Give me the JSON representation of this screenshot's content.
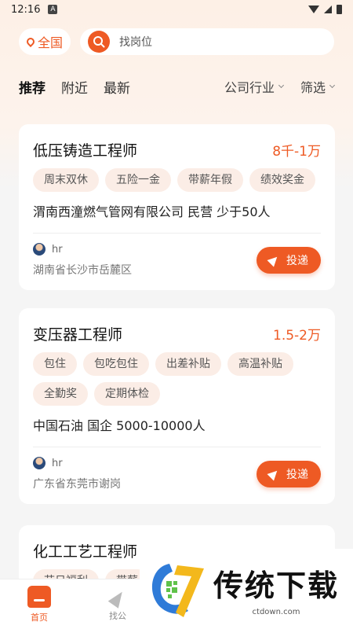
{
  "status_bar": {
    "time": "12:16",
    "notif_letter": "A"
  },
  "header": {
    "region": "全国",
    "search_placeholder": "找岗位"
  },
  "tabs": [
    {
      "label": "推荐",
      "active": true
    },
    {
      "label": "附近",
      "active": false
    },
    {
      "label": "最新",
      "active": false
    }
  ],
  "filters": {
    "industry": "公司行业",
    "filter": "筛选"
  },
  "jobs": [
    {
      "title": "低压铸造工程师",
      "salary": "8千-1万",
      "tags": [
        "周末双休",
        "五险一金",
        "带薪年假",
        "绩效奖金"
      ],
      "company": "渭南西潼燃气管网有限公司 民营 少于50人",
      "hr": "hr",
      "location": "湖南省长沙市岳麓区",
      "apply": "投递"
    },
    {
      "title": "变压器工程师",
      "salary": "1.5-2万",
      "tags": [
        "包住",
        "包吃包住",
        "出差补贴",
        "高温补贴",
        "全勤奖",
        "定期体检"
      ],
      "company": "中国石油 国企 5000-10000人",
      "hr": "hr",
      "location": "广东省东莞市谢岗",
      "apply": "投递"
    },
    {
      "title": "化工工艺工程师",
      "salary": "",
      "tags": [
        "节日福利",
        "带薪"
      ]
    }
  ],
  "tabbar": [
    {
      "label": "首页",
      "icon": "home-icon",
      "active": true
    },
    {
      "label": "找公",
      "icon": "send-icon",
      "active": false
    }
  ],
  "watermark": {
    "brand": "传统下载",
    "site": "ctdown.com"
  },
  "colors": {
    "accent": "#ee5a24",
    "tag_bg": "#fbede6"
  }
}
